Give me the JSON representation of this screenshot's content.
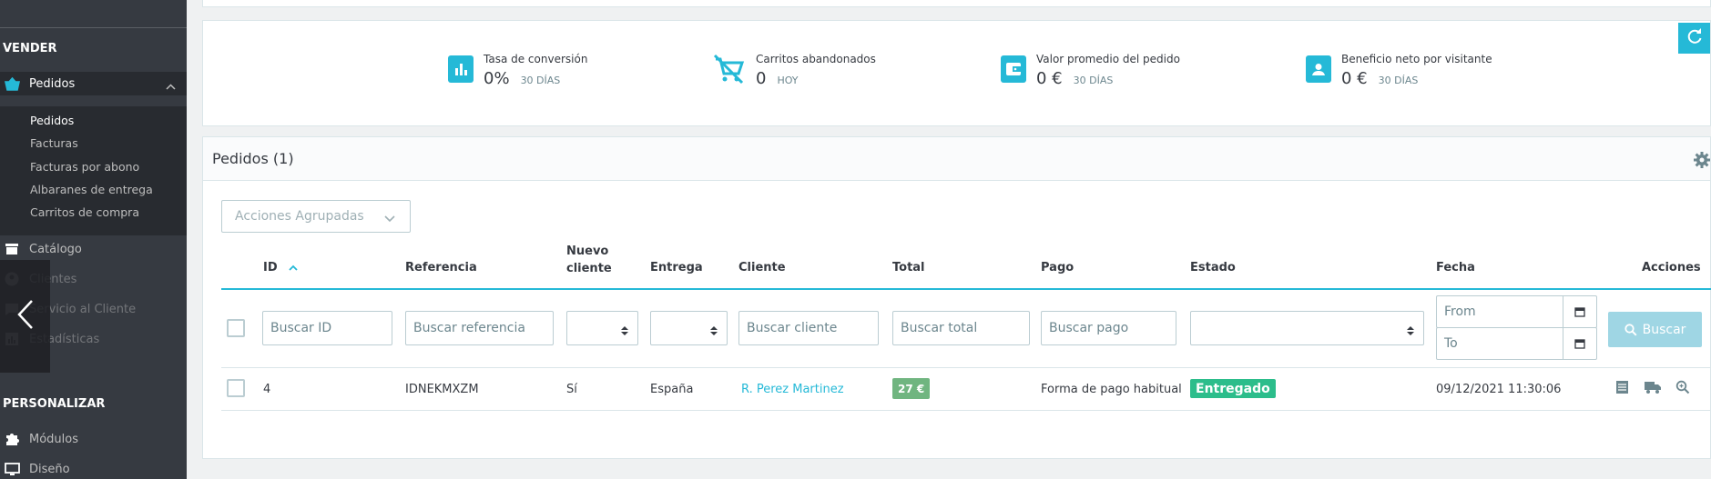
{
  "sidebar": {
    "section_sell": "VENDER",
    "orders": "Pedidos",
    "sub": [
      "Pedidos",
      "Facturas",
      "Facturas por abono",
      "Albaranes de entrega",
      "Carritos de compra"
    ],
    "catalog": "Catálogo",
    "customers": "Clientes",
    "customer_service": "Servicio al Cliente",
    "stats": "Estadísticas",
    "section_customize": "PERSONALIZAR",
    "modules": "Módulos",
    "design": "Diseño"
  },
  "kpis": [
    {
      "title": "Tasa de conversión",
      "value": "0%",
      "period": "30 DÍAS",
      "color": "#25b9d7",
      "icon": "bar-chart-icon"
    },
    {
      "title": "Carritos abandonados",
      "value": "0",
      "period": "HOY",
      "color": "#25b9d7",
      "icon": "remove-cart-icon"
    },
    {
      "title": "Valor promedio del pedido",
      "value": "0 €",
      "period": "30 DÍAS",
      "color": "#25b9d7",
      "icon": "wallet-icon"
    },
    {
      "title": "Beneficio neto por visitante",
      "value": "0 €",
      "period": "30 DÍAS",
      "color": "#25b9d7",
      "icon": "account-box-icon"
    }
  ],
  "orders_panel": {
    "title": "Pedidos (1)",
    "bulk_actions": "Acciones Agrupadas",
    "columns": [
      "ID",
      "Referencia",
      "Nuevo cliente",
      "Entrega",
      "Cliente",
      "Total",
      "Pago",
      "Estado",
      "Fecha",
      "Acciones"
    ],
    "col_new_customer_line1": "Nuevo",
    "col_new_customer_line2": "cliente",
    "filters": {
      "id": "Buscar ID",
      "reference": "Buscar referencia",
      "customer": "Buscar cliente",
      "total": "Buscar total",
      "payment": "Buscar pago",
      "date_from": "From",
      "date_to": "To"
    },
    "search_button": "Buscar",
    "rows": [
      {
        "id": "4",
        "reference": "IDNEKMXZM",
        "new_customer": "Sí",
        "delivery": "España",
        "customer": "R. Perez Martinez",
        "total": "27 €",
        "payment": "Forma de pago habitual",
        "status": "Entregado",
        "date": "09/12/2021 11:30:06"
      }
    ]
  },
  "colors": {
    "accent": "#25b9d7",
    "sidebar": "#363a41",
    "status_delivered": "#2cbd8b",
    "total_badge": "#70b580"
  }
}
